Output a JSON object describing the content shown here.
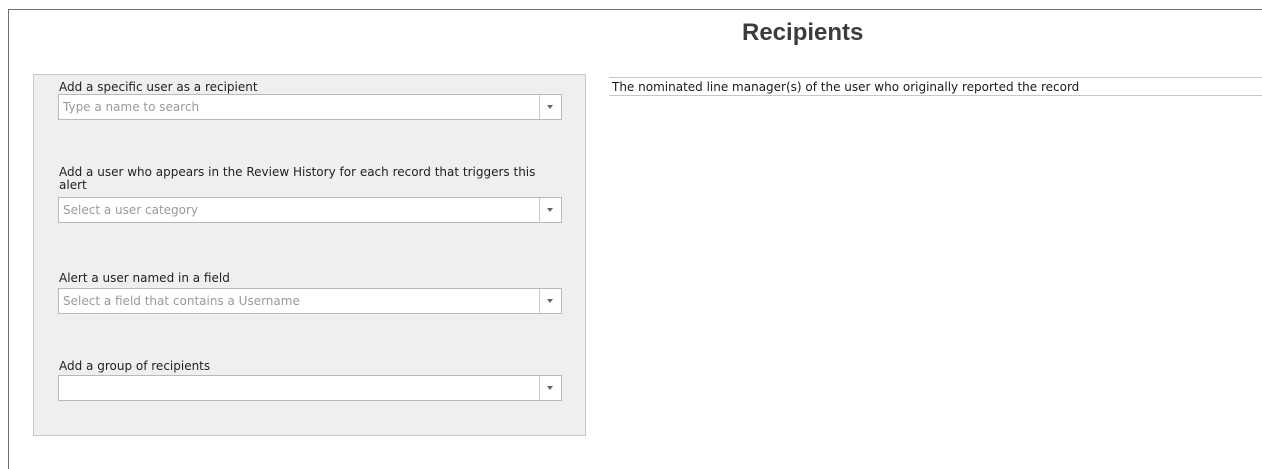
{
  "page": {
    "title": "Recipients"
  },
  "form": {
    "specific_user": {
      "label": "Add a specific user as a recipient",
      "placeholder": "Type a name to search"
    },
    "review_history_user": {
      "label": "Add a user who appears in the Review History for each record that triggers this alert",
      "placeholder": "Select a user category"
    },
    "named_field_user": {
      "label": "Alert a user named in a field",
      "placeholder": "Select a field that contains a Username"
    },
    "group": {
      "label": "Add a group of recipients",
      "placeholder": ""
    }
  },
  "recipients": {
    "items": [
      "The nominated line manager(s) of the user who originally reported the record"
    ]
  },
  "icons": {
    "dropdown": "chevron-down-icon"
  }
}
